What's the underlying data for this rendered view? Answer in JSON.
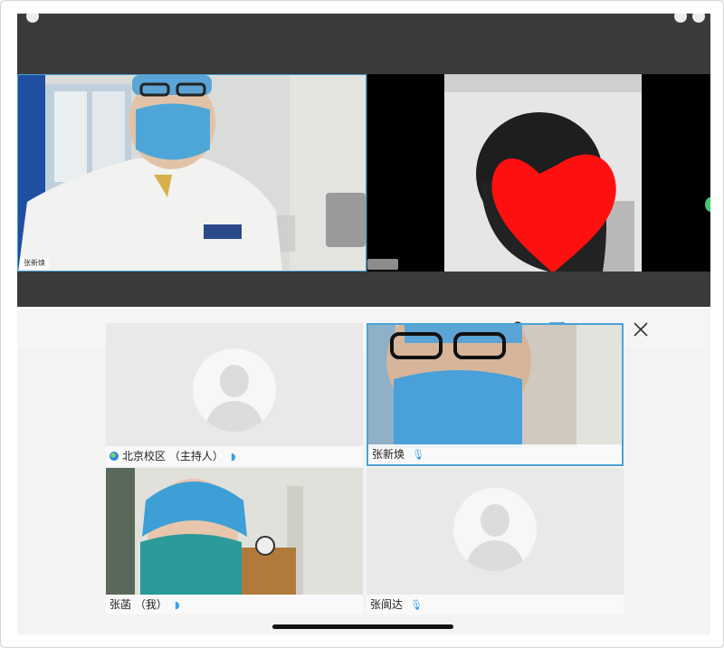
{
  "top_screenshot": {
    "left_tag": "张新焕"
  },
  "toolbar": {
    "participants_icon": "person-list-icon",
    "screen_share_icon": "share-screen-icon",
    "more_icon": "more-icon",
    "close_icon": "close-icon"
  },
  "tiles": [
    {
      "name": "北京校区 （主持人）",
      "type": "avatar"
    },
    {
      "name": "张新焕",
      "type": "video",
      "active": true
    },
    {
      "name": "张菡 （我）",
      "type": "video"
    },
    {
      "name": "张阆达",
      "type": "avatar"
    }
  ],
  "colors": {
    "accent": "#4aa3d8",
    "mic": "#3aa0e8"
  }
}
